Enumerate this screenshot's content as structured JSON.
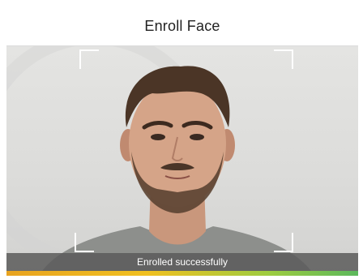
{
  "window": {
    "title": "Enroll Face"
  },
  "status": {
    "message": "Enrolled successfully"
  },
  "progress": {
    "fraction": 1.0
  },
  "colors": {
    "status_bg": "#5a5a5a",
    "progress_start": "#e8a320",
    "progress_end": "#5cb85c"
  },
  "icons": {
    "face_frame_corners": "bracket-corner-icon"
  }
}
